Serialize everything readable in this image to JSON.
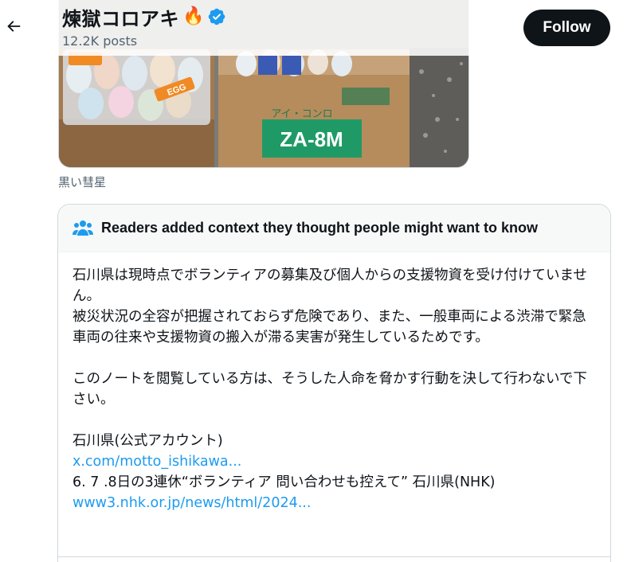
{
  "header": {
    "profile_name": "煉獄コロアキ",
    "flame_emoji": "🔥",
    "post_count": "12.2K posts",
    "follow_label": "Follow",
    "icons": {
      "back": "back-arrow-icon",
      "verified": "verified-badge-icon"
    },
    "verified_color": "#1d9bf0"
  },
  "photo": {
    "box_label_top": "アイ・コンロ",
    "box_label_main": "ZA-8M",
    "egg_label": "EGG",
    "caption": "黒い彗星"
  },
  "note": {
    "icon": "people-icon",
    "title": "Readers added context they thought people might want to know",
    "paragraph1": "石川県は現時点でボランティアの募集及び個人からの支援物資を受け付けていません。",
    "paragraph2": "被災状況の全容が把握されておらず危険であり、また、一般車両による渋滞で緊急車両の往来や支援物資の搬入が滞る実害が発生しているためです。",
    "paragraph3": "このノートを閲覧している方は、そうした人命を脅かす行動を決して行わないで下さい。",
    "source1_label": "石川県(公式アカウント)",
    "source1_link": "x.com/motto_ishikawa...",
    "source2_label": "6. 7 .8日の3連休“ボランティア 問い合わせも控えて” 石川県(NHK)",
    "source2_link": "www3.nhk.or.jp/news/html/2024..."
  },
  "colors": {
    "link": "#1d9bf0",
    "follow_bg": "#0f1419",
    "muted_text": "#536471"
  }
}
